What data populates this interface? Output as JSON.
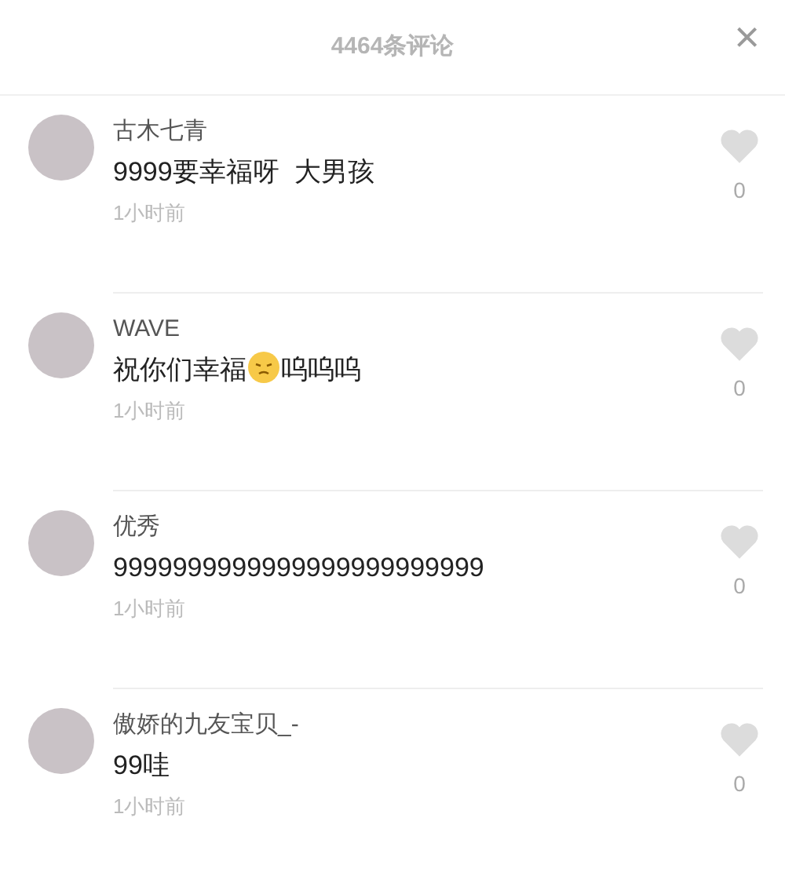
{
  "header": {
    "title": "4464条评论",
    "close": "×"
  },
  "comments": [
    {
      "user": "古木七青",
      "segments": [
        {
          "kind": "text",
          "text": "9999要幸福呀  大男孩"
        }
      ],
      "time": "1小时前",
      "liked": false,
      "likes": "0"
    },
    {
      "user": "WAVE",
      "segments": [
        {
          "kind": "text",
          "text": "祝你们幸福"
        },
        {
          "kind": "emoji"
        },
        {
          "kind": "text",
          "text": "呜呜呜"
        }
      ],
      "time": "1小时前",
      "liked": false,
      "likes": "0"
    },
    {
      "user": "优秀",
      "segments": [
        {
          "kind": "text",
          "text": "9999999999999999999999999"
        }
      ],
      "time": "1小时前",
      "liked": false,
      "likes": "0"
    },
    {
      "user": "傲娇的九友宝贝_-",
      "segments": [
        {
          "kind": "text",
          "text": "99哇"
        }
      ],
      "time": "1小时前",
      "liked": false,
      "likes": "0"
    }
  ]
}
